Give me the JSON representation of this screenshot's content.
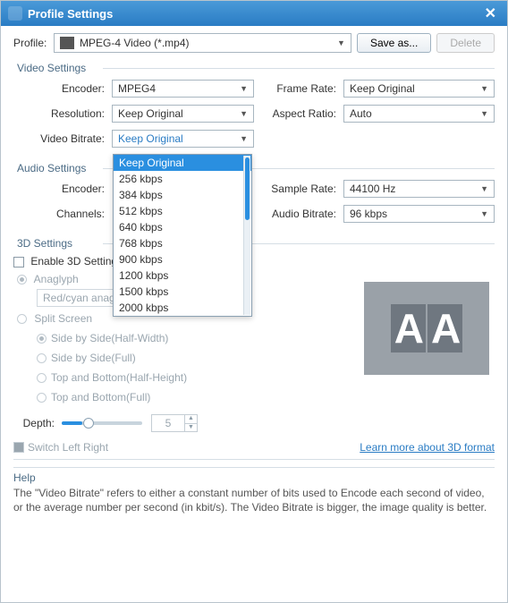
{
  "titlebar": {
    "title": "Profile Settings"
  },
  "profile_row": {
    "label": "Profile:",
    "value": "MPEG-4 Video (*.mp4)",
    "save_as": "Save as...",
    "delete": "Delete"
  },
  "video": {
    "group": "Video Settings",
    "encoder_label": "Encoder:",
    "encoder_value": "MPEG4",
    "framerate_label": "Frame Rate:",
    "framerate_value": "Keep Original",
    "resolution_label": "Resolution:",
    "resolution_value": "Keep Original",
    "aspect_label": "Aspect Ratio:",
    "aspect_value": "Auto",
    "bitrate_label": "Video Bitrate:",
    "bitrate_value": "Keep Original",
    "bitrate_options": [
      "Keep Original",
      "256 kbps",
      "384 kbps",
      "512 kbps",
      "640 kbps",
      "768 kbps",
      "900 kbps",
      "1200 kbps",
      "1500 kbps",
      "2000 kbps"
    ]
  },
  "audio": {
    "group": "Audio Settings",
    "encoder_label": "Encoder:",
    "sample_label": "Sample Rate:",
    "sample_value": "44100 Hz",
    "channels_label": "Channels:",
    "abitrate_label": "Audio Bitrate:",
    "abitrate_value": "96 kbps"
  },
  "threeD": {
    "group": "3D Settings",
    "enable": "Enable 3D Settings",
    "anaglyph": "Anaglyph",
    "anaglyph_value": "Red/cyan anaglyph, full color",
    "split": "Split Screen",
    "opt1": "Side by Side(Half-Width)",
    "opt2": "Side by Side(Full)",
    "opt3": "Top and Bottom(Half-Height)",
    "opt4": "Top and Bottom(Full)",
    "depth_label": "Depth:",
    "depth_value": "5",
    "switch_label": "Switch Left Right",
    "link": "Learn more about 3D format"
  },
  "help": {
    "group": "Help",
    "text": "The \"Video Bitrate\" refers to either a constant number of bits used to Encode each second of video, or the average number per second (in kbit/s). The Video Bitrate is bigger, the image quality is better."
  }
}
